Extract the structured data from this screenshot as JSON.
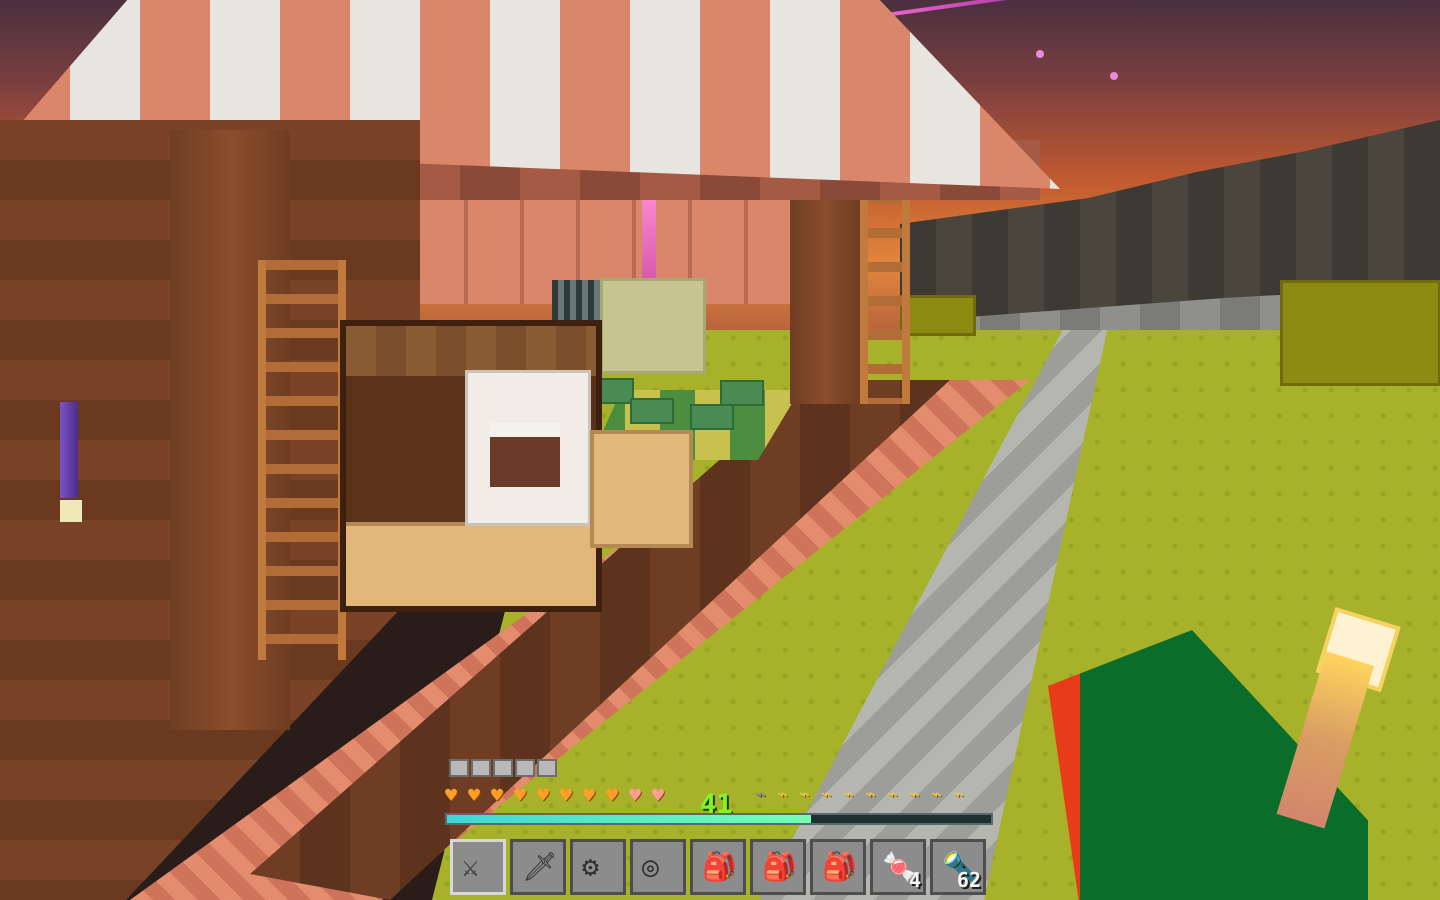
{
  "hud": {
    "armor_points": 5,
    "health": {
      "full": 8,
      "empty": 2
    },
    "hunger": {
      "full": 9,
      "empty": 1
    },
    "level": "41",
    "experience_fraction": 0.67,
    "hotbar": [
      {
        "icon": "feather-sword-icon",
        "glyph": "⚔",
        "count": ""
      },
      {
        "icon": "stone-sword-icon",
        "glyph": "🗡",
        "count": ""
      },
      {
        "icon": "blue-spring-icon",
        "glyph": "⚙",
        "count": ""
      },
      {
        "icon": "spiral-icon",
        "glyph": "◎",
        "count": ""
      },
      {
        "icon": "green-backpack-icon",
        "glyph": "🎒",
        "count": ""
      },
      {
        "icon": "white-backpack-icon",
        "glyph": "🎒",
        "count": ""
      },
      {
        "icon": "yellow-backpack-icon",
        "glyph": "🎒",
        "count": ""
      },
      {
        "icon": "candy-icon",
        "glyph": "🍬",
        "count": "4"
      },
      {
        "icon": "torch-icon",
        "glyph": "🔦",
        "count": "62"
      }
    ]
  },
  "colors": {
    "health": "#ff9f2a",
    "level": "#7ef52e",
    "hunger": "#f2c84a",
    "xp": "#3fd7d4"
  }
}
